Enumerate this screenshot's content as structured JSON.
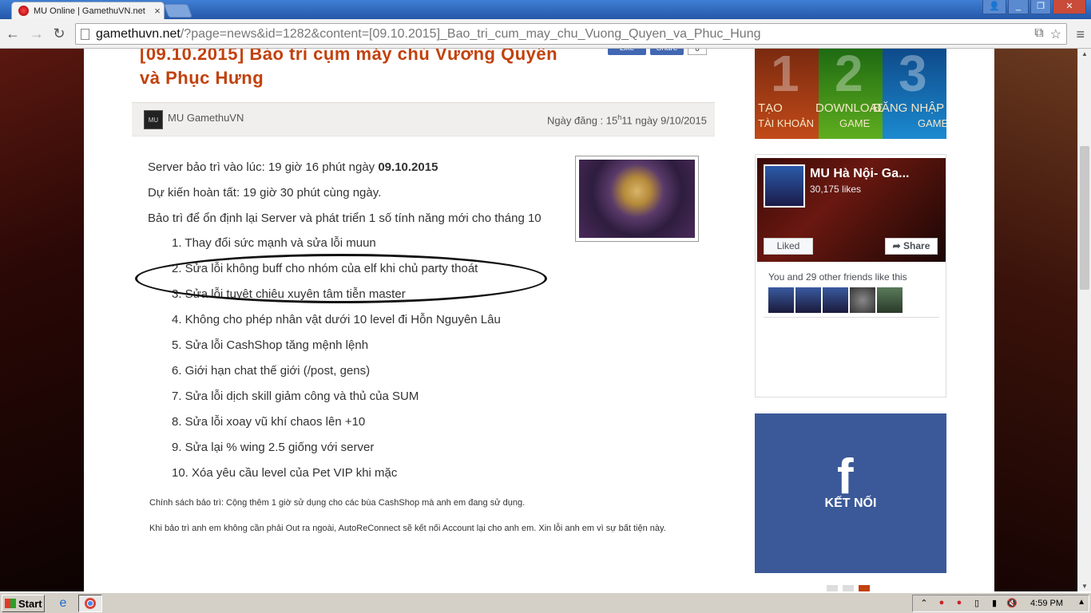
{
  "browser": {
    "tab_title": "MU Online | GamethuVN.net",
    "tab_close": "×",
    "url_host": "gamethuvn.net",
    "url_path": "/?page=news&id=1282&content=[09.10.2015]_Bao_tri_cum_may_chu_Vuong_Quyen_va_Phuc_Hung",
    "back": "←",
    "forward": "→",
    "reload": "↻",
    "star": "☆",
    "menu": "≡"
  },
  "article": {
    "title_line1": "[09.10.2015] Bảo trì cụm máy chủ Vương Quyền",
    "title_line2": "và Phục Hưng",
    "fb_like": "Like",
    "fb_share": "Share",
    "fb_count": "0",
    "author_avatar": "MU",
    "author": "MU GamethuVN",
    "posted_prefix": "Ngày đăng :  15",
    "posted_sup": "h",
    "posted_suffix": "11 ngày 9/10/2015",
    "line1_text": "Server bảo trì vào lúc: 19 giờ 16 phút ngày ",
    "line1_bold": "09.10.2015",
    "line2": "Dự kiến hoàn tất: 19 giờ 30 phút cùng ngày.",
    "line3": "Bảo trì để ổn định lại Server và phát triển 1 số tính năng mới cho tháng 10",
    "items": [
      "1. Thay đổi sức mạnh và sửa lỗi muun",
      "2. Sửa lỗi không buff cho nhóm của elf khi chủ party thoát",
      "3. Sửa lỗi tuyệt chiêu xuyên tâm tiễn master",
      "4. Không cho phép nhân vật dưới 10 level đi Hỗn Nguyên Lâu",
      "5. Sửa lỗi CashShop tăng mệnh lệnh",
      "6. Giới hạn chat thế giới (/post, gens)",
      "7. Sửa lỗi dịch skill giảm công và thủ của SUM",
      "8. Sửa lỗi xoay vũ khí chaos lên +10",
      "9. Sửa lại % wing 2.5 giống với server",
      "10.  Xóa yêu cầu level của Pet VIP khi mặc"
    ],
    "note1": "Chính sách bảo trì: Cộng thêm 1 giờ sử dụng cho các bùa CashShop mà anh em đang sử dụng.",
    "note2": "Khi bảo trì anh em không cần phải Out ra ngoài, AutoReConnect sẽ kết nối Account lại cho anh em. Xin lỗi anh em vì sự bất tiện này."
  },
  "sidebar": {
    "banner": [
      {
        "num": "1",
        "line1": "TẠO",
        "line2": "TÀI KHOẢN"
      },
      {
        "num": "2",
        "line1": "DOWNLOAD",
        "line2": "GAME"
      },
      {
        "num": "3",
        "line1": "ĐĂNG NHẬP",
        "line2": "GAME"
      }
    ],
    "fb_page_name": "MU Hà Nội- Ga...",
    "fb_page_likes": "30,175 likes",
    "fb_liked": "Liked",
    "fb_share": "Share",
    "fb_friends": "You and 29 other friends like this",
    "connect_icon": "f",
    "connect_label": "KẾT NỐI"
  },
  "taskbar": {
    "start": "Start",
    "clock": "4:59 PM"
  },
  "colors": {
    "title": "#c2410c",
    "facebook": "#3b5998",
    "tab_bar": "#2457a8"
  }
}
